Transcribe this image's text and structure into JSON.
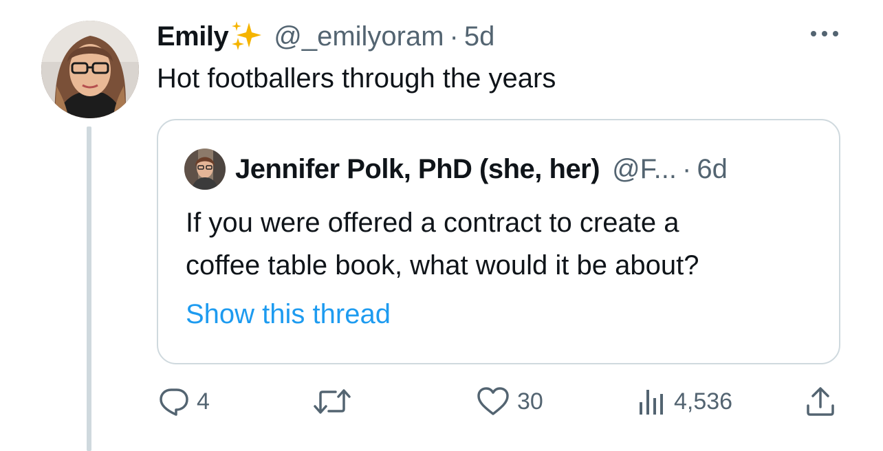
{
  "tweet": {
    "display_name": "Emily",
    "badge_icon": "sparkles-icon",
    "handle": "@_emilyoram",
    "separator": "·",
    "time": "5d",
    "text": "Hot footballers through the years"
  },
  "quote": {
    "display_name": "Jennifer Polk, PhD (she, her)",
    "handle": "@F...",
    "separator": "·",
    "time": "6d",
    "text_lines": [
      "If you were offered a contract to create a",
      "coffee table book, what would it be about?"
    ],
    "show_thread": "Show this thread"
  },
  "actions": {
    "reply_count": "4",
    "like_count": "30",
    "views_count": "4,536"
  },
  "colors": {
    "text": "#0f1419",
    "secondary": "#536471",
    "link": "#1d9bf0",
    "border": "#cfd9de",
    "badge": "#f5b400"
  }
}
